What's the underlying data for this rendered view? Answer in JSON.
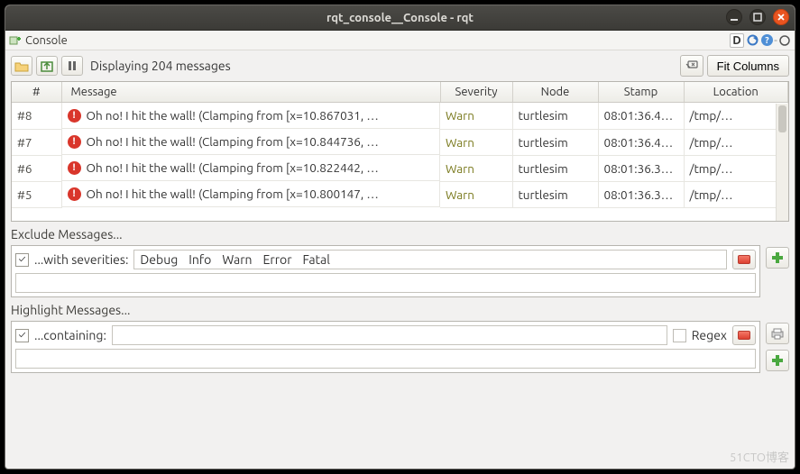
{
  "window": {
    "title": "rqt_console__Console - rqt"
  },
  "dock": {
    "tab_label": "Console",
    "d_icon_text": "D",
    "dash_text": "-"
  },
  "toolbar": {
    "summary": "Displaying 204 messages",
    "fit_label": "Fit Columns"
  },
  "table": {
    "headers": {
      "idx": "#",
      "message": "Message",
      "severity": "Severity",
      "node": "Node",
      "stamp": "Stamp",
      "location": "Location"
    },
    "rows": [
      {
        "idx": "#8",
        "message": "Oh no! I hit the wall! (Clamping from [x=10.867031, …",
        "severity": "Warn",
        "node": "turtlesim",
        "stamp": "08:01:36.4…",
        "location": "/tmp/…"
      },
      {
        "idx": "#7",
        "message": "Oh no! I hit the wall! (Clamping from [x=10.844736, …",
        "severity": "Warn",
        "node": "turtlesim",
        "stamp": "08:01:36.4…",
        "location": "/tmp/…"
      },
      {
        "idx": "#6",
        "message": "Oh no! I hit the wall! (Clamping from [x=10.822442, …",
        "severity": "Warn",
        "node": "turtlesim",
        "stamp": "08:01:36.3…",
        "location": "/tmp/…"
      },
      {
        "idx": "#5",
        "message": "Oh no! I hit the wall! (Clamping from [x=10.800147, …",
        "severity": "Warn",
        "node": "turtlesim",
        "stamp": "08:01:36.3…",
        "location": "/tmp/…"
      }
    ]
  },
  "exclude": {
    "section_label": "Exclude Messages...",
    "row_label": "...with severities:",
    "severities": [
      "Debug",
      "Info",
      "Warn",
      "Error",
      "Fatal"
    ],
    "checked": "✓"
  },
  "highlight": {
    "section_label": "Highlight Messages...",
    "row_label": "...containing:",
    "regex_label": "Regex",
    "input_value": "",
    "checked": "✓"
  },
  "watermark": "51CTO博客"
}
